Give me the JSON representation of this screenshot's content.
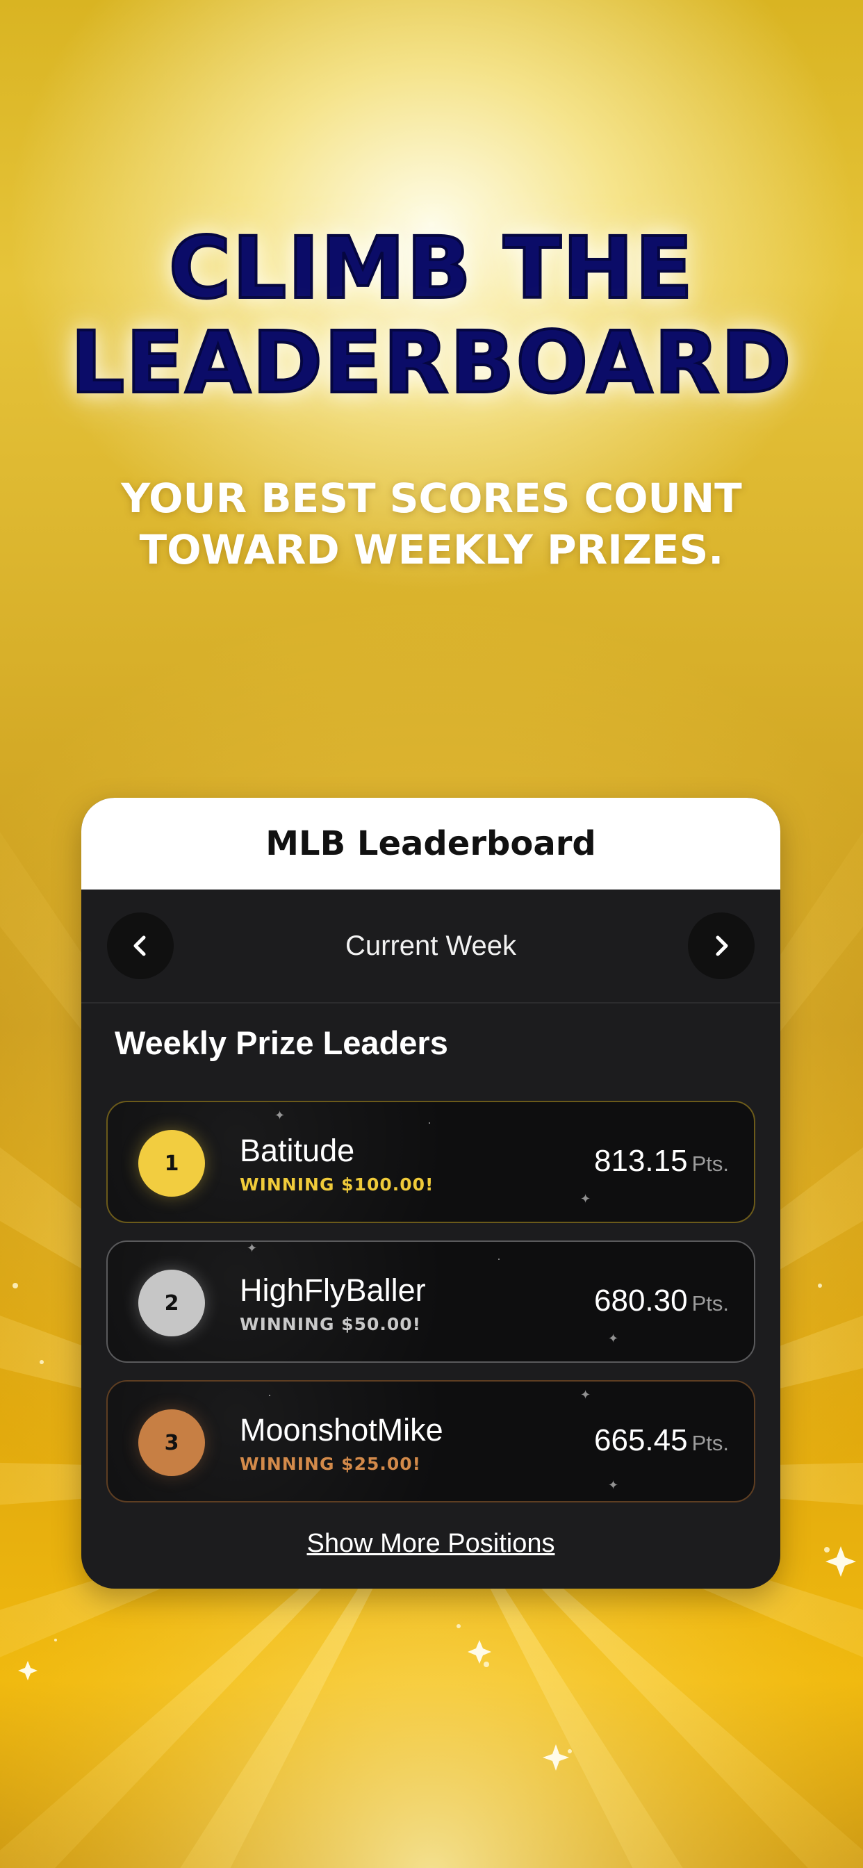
{
  "hero": {
    "title_line1": "CLIMB THE",
    "title_line2": "LEADERBOARD",
    "subtitle_line1": "YOUR BEST SCORES COUNT",
    "subtitle_line2": "TOWARD WEEKLY PRIZES."
  },
  "card": {
    "title": "MLB Leaderboard",
    "week_label": "Current Week",
    "prev_icon": "chevron-left-icon",
    "next_icon": "chevron-right-icon",
    "section_title": "Weekly Prize Leaders",
    "show_more_label": "Show More Positions"
  },
  "leaders": [
    {
      "rank": "1",
      "name": "Batitude",
      "prize": "WINNING $100.00!",
      "score": "813.15",
      "unit": "Pts."
    },
    {
      "rank": "2",
      "name": "HighFlyBaller",
      "prize": "WINNING $50.00!",
      "score": "680.30",
      "unit": "Pts."
    },
    {
      "rank": "3",
      "name": "MoonshotMike",
      "prize": "WINNING $25.00!",
      "score": "665.45",
      "unit": "Pts."
    }
  ],
  "colors": {
    "title_navy": "#0b0c68",
    "gold": "#f2cd40",
    "silver": "#c6c6c6",
    "bronze": "#c77f44",
    "card_dark": "#1c1c1e"
  }
}
